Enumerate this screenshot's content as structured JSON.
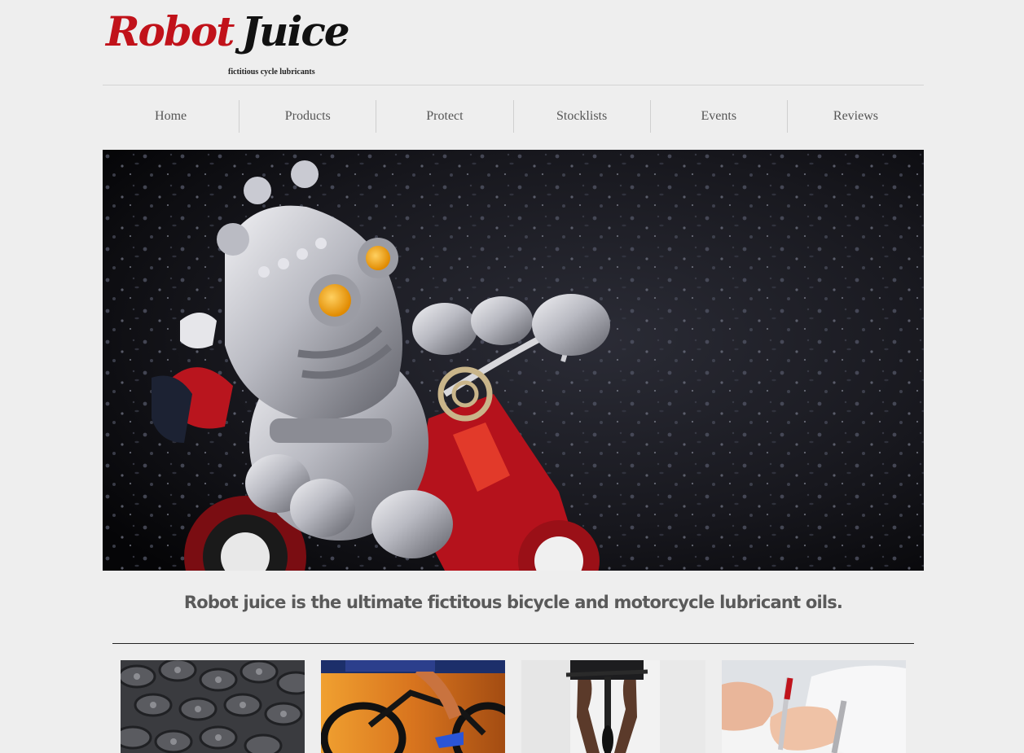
{
  "brand": {
    "name_part1": "Robot",
    "name_part2": "Juice",
    "tagline": "fictitious cycle lubricants",
    "colors": {
      "accent_red": "#c1121a",
      "dark": "#111111",
      "background": "#eeeeee"
    }
  },
  "nav": {
    "items": [
      {
        "label": "Home"
      },
      {
        "label": "Products"
      },
      {
        "label": "Protect"
      },
      {
        "label": "Stocklists"
      },
      {
        "label": "Events"
      },
      {
        "label": "Reviews"
      }
    ]
  },
  "hero": {
    "image": "robot-riding-tricycle-photo"
  },
  "main": {
    "headline": "Robot juice is the ultimate fictitous bicycle and motorcycle lubricant oils."
  },
  "thumbnails": [
    {
      "image": "bike-chain-photo"
    },
    {
      "image": "cyclist-racing-photo"
    },
    {
      "image": "cyclist-rear-view-photo"
    },
    {
      "image": "hand-signing-document-photo"
    }
  ]
}
